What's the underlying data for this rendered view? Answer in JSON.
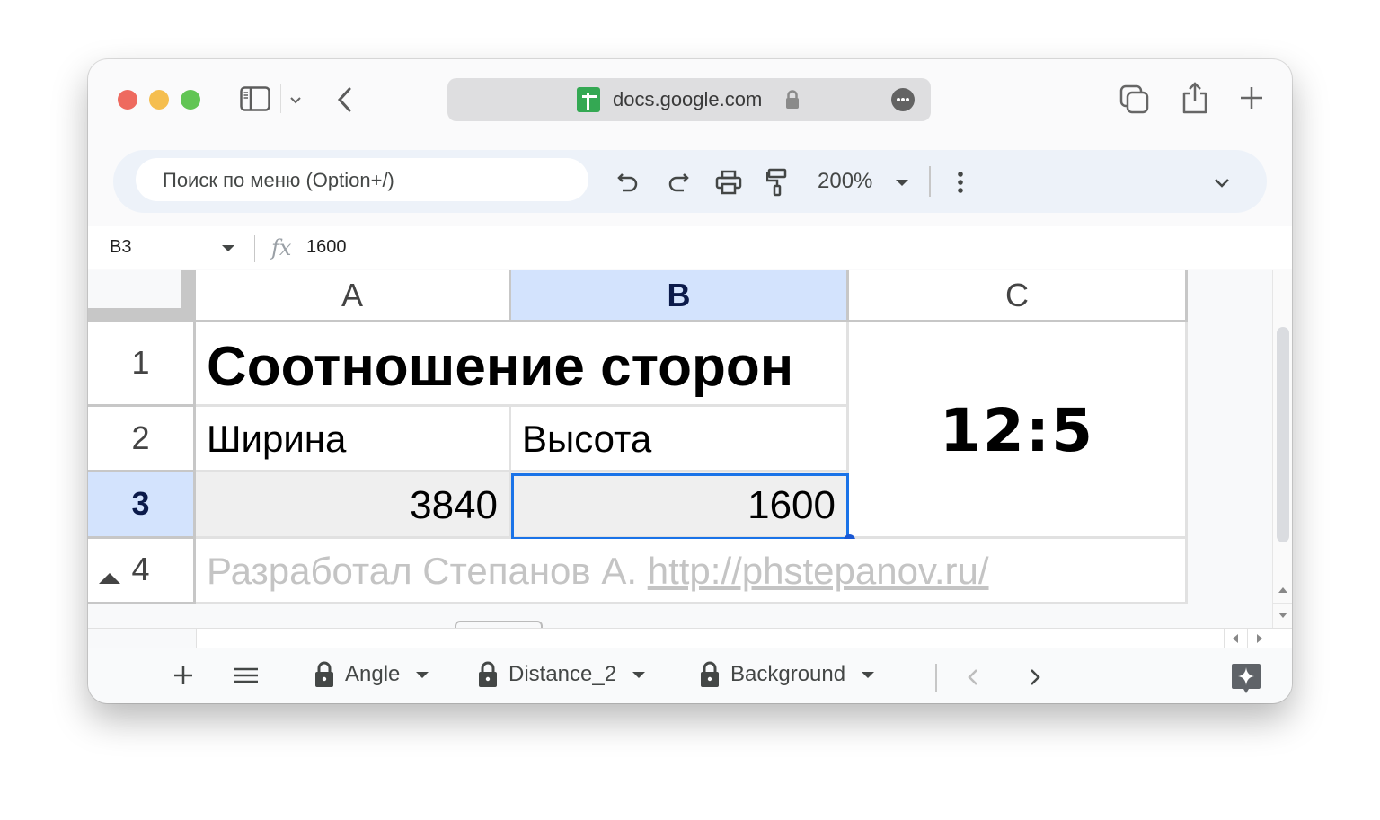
{
  "browser": {
    "url": "docs.google.com",
    "site_icon": "google-sheets-icon",
    "traffic_lights": {
      "close": "#ee6a5f",
      "minimize": "#f5be4f",
      "maximize": "#61c554"
    }
  },
  "toolbar": {
    "search_placeholder": "Поиск по меню (Option+/)",
    "zoom": "200%"
  },
  "formula_bar": {
    "cell_ref": "B3",
    "fx": "fx",
    "value": "1600"
  },
  "grid": {
    "columns": [
      "A",
      "B",
      "C"
    ],
    "rows": [
      "1",
      "2",
      "3",
      "4"
    ],
    "selected_column": "B",
    "selected_row": "3",
    "cells": {
      "A1": "Соотношение сторон",
      "A2": "Ширина",
      "B2": "Высота",
      "A3": "3840",
      "B3": "1600",
      "C1": "12:5",
      "A4_text": "Разработал Степанов А.",
      "A4_link": "http://phstepanov.ru/"
    },
    "accent": "#1a73e8"
  },
  "sheets": {
    "tabs": [
      {
        "label": "Angle",
        "locked": true
      },
      {
        "label": "Distance_2",
        "locked": true
      },
      {
        "label": "Background",
        "locked": true
      }
    ]
  }
}
